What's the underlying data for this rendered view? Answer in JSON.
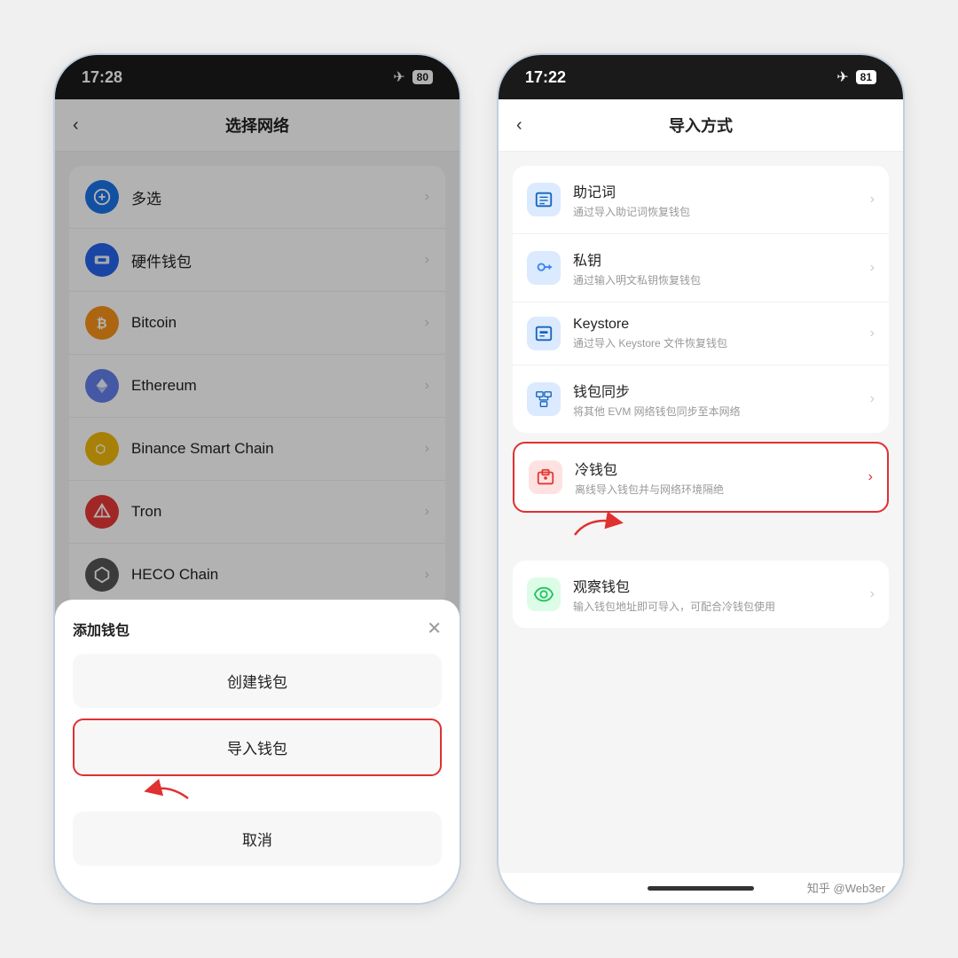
{
  "phone1": {
    "statusBar": {
      "time": "17:28",
      "battery": "80"
    },
    "header": {
      "back": "‹",
      "title": "选择网络"
    },
    "networkList": [
      {
        "id": "multi",
        "label": "多选",
        "iconType": "multi",
        "color": "#1a73e8"
      },
      {
        "id": "hardware",
        "label": "硬件钱包",
        "iconType": "hardware",
        "color": "#2563eb"
      },
      {
        "id": "bitcoin",
        "label": "Bitcoin",
        "iconType": "bitcoin",
        "color": "#f7931a"
      },
      {
        "id": "ethereum",
        "label": "Ethereum",
        "iconType": "ethereum",
        "color": "#627eea"
      },
      {
        "id": "bnb",
        "label": "Binance Smart Chain",
        "iconType": "bnb",
        "color": "#f0b90b"
      },
      {
        "id": "tron",
        "label": "Tron",
        "iconType": "tron",
        "color": "#e53935"
      },
      {
        "id": "heco",
        "label": "HECO Chain",
        "iconType": "heco",
        "color": "#555"
      }
    ],
    "modal": {
      "title": "添加钱包",
      "createLabel": "创建钱包",
      "importLabel": "导入钱包",
      "cancelLabel": "取消"
    }
  },
  "phone2": {
    "statusBar": {
      "time": "17:22",
      "battery": "81"
    },
    "header": {
      "back": "‹",
      "title": "导入方式"
    },
    "importMethods": [
      {
        "id": "mnemonic",
        "title": "助记词",
        "sub": "通过导入助记词恢复钱包",
        "iconType": "mnemonic"
      },
      {
        "id": "privatekey",
        "title": "私钥",
        "sub": "通过输入明文私钥恢复钱包",
        "iconType": "key"
      },
      {
        "id": "keystore",
        "title": "Keystore",
        "sub": "通过导入 Keystore 文件恢复钱包",
        "iconType": "keystore"
      },
      {
        "id": "sync",
        "title": "钱包同步",
        "sub": "将其他 EVM 网络钱包同步至本网络",
        "iconType": "sync"
      }
    ],
    "coldWallet": {
      "title": "冷钱包",
      "sub": "离线导入钱包并与网络环境隔绝",
      "iconType": "cold"
    },
    "watchWallet": {
      "title": "观察钱包",
      "sub": "输入钱包地址即可导入，可配合冷钱包使用",
      "iconType": "watch"
    }
  },
  "watermark": "知乎 @Web3er"
}
